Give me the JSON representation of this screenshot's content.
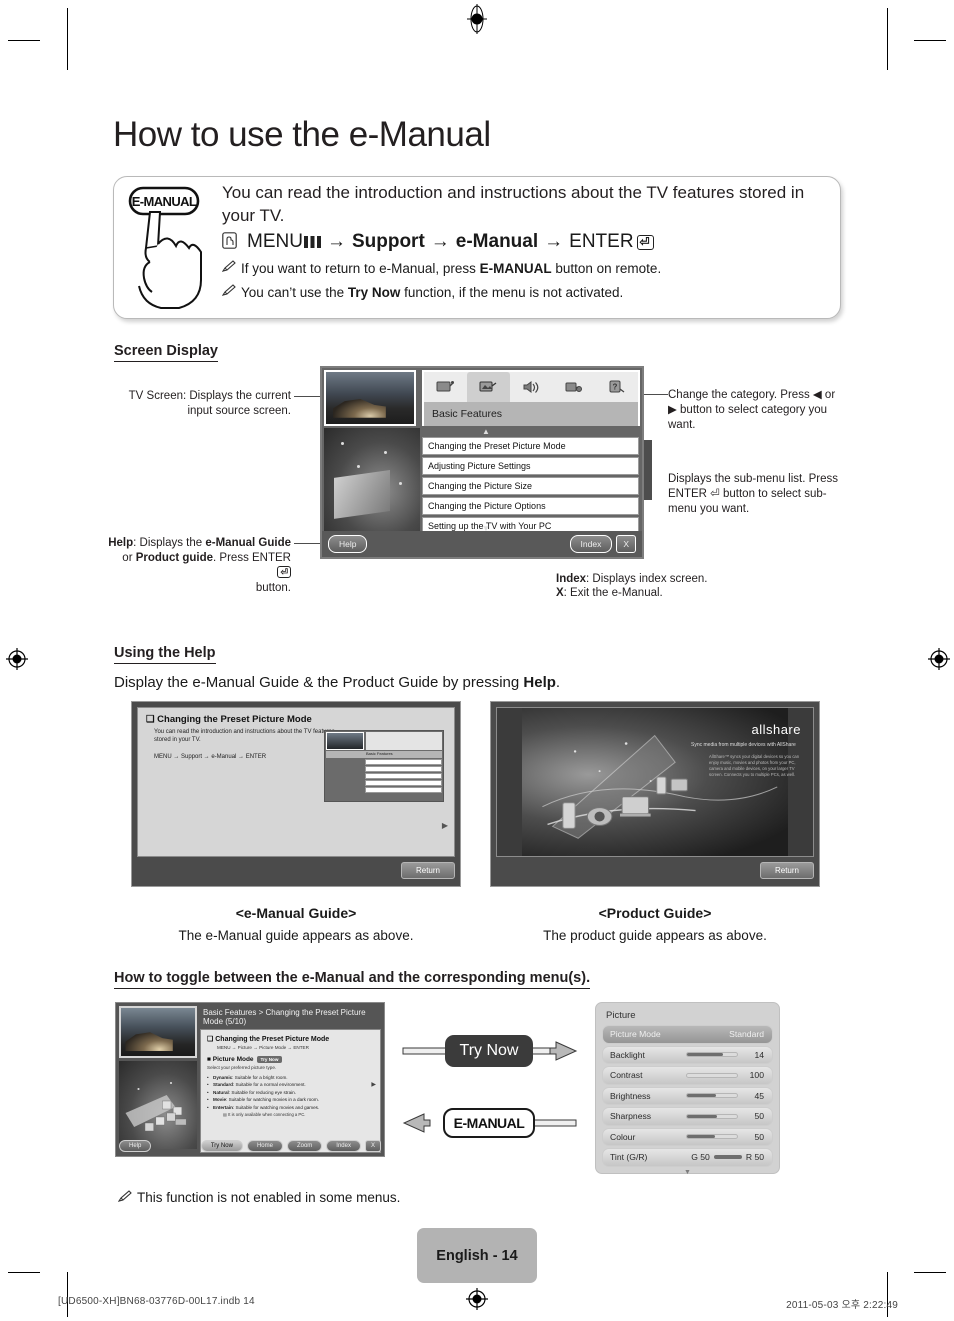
{
  "page": {
    "title": "How to use the e-Manual",
    "page_badge": "English - 14",
    "footer_left": "[UD6500-XH]BN68-03776D-00L17.indb   14",
    "footer_right": "2011-05-03   오후 2:22:49"
  },
  "infobox": {
    "button_label": "E-MANUAL",
    "lead": "You can read the introduction and instructions about the TV features stored in your TV.",
    "path": {
      "menu": "MENU",
      "arrow": "→",
      "support": "Support",
      "emanual": "e-Manual",
      "enter": "ENTER"
    },
    "notes": [
      {
        "pre": "If you want to return to e-Manual, press ",
        "bold": "E-MANUAL",
        "post": " button on remote."
      },
      {
        "pre": "You can’t use the ",
        "bold": "Try Now",
        "post": " function, if the menu is not activated."
      }
    ]
  },
  "screen_display": {
    "heading": "Screen Display",
    "anno_tv_screen": "TV Screen: Displays the current input source screen.",
    "anno_help_1": "Help",
    "anno_help_2": ": Displays the ",
    "anno_help_3": "e-Manual Guide",
    "anno_help_4": " or ",
    "anno_help_5": "Product guide",
    "anno_help_6": ". Press ENTER",
    "anno_help_7": "button.",
    "anno_category": "Change the category. Press ◀ or ▶ button to select category you want.",
    "anno_submenu": "Displays the sub-menu list. Press ENTER ⏎ button to select sub-menu you want.",
    "anno_index_1": "Index",
    "anno_index_2": ": Displays index screen.",
    "anno_x_1": "X",
    "anno_x_2": ": Exit the e-Manual.",
    "ui": {
      "category_title": "Basic Features",
      "categories": [
        "tv-icon",
        "picture-icon",
        "sound-icon",
        "network-icon",
        "support-icon"
      ],
      "selected_category_index": 1,
      "menu_items": [
        "Changing the Preset Picture Mode",
        "Adjusting Picture Settings",
        "Changing the Picture Size",
        "Changing the Picture Options",
        "Setting up the TV with Your PC"
      ],
      "help_key": "Help",
      "index_key": "Index",
      "exit_key": "X"
    }
  },
  "using_help": {
    "heading": "Using the Help",
    "intro_pre": "Display the e-Manual Guide & the Product Guide by pressing ",
    "intro_bold": "Help",
    "intro_post": ".",
    "emanual_guide": {
      "screen_title": "Changing the Preset Picture Mode",
      "body": "You can read the introduction and instructions about the TV features stored in your TV.",
      "path": "MENU      →  Support  →  e-Manual  →  ENTER",
      "return_key": "Return",
      "caption_title": "<e-Manual Guide>",
      "caption_sub": "The e-Manual guide appears as above."
    },
    "product_guide": {
      "logo": "allshare",
      "tagline": "Sync media from multiple devices with AllShare",
      "body": "AllShare™ syncs your digital devices so you can enjoy music, movies and photos from your PC, camera and mobile devices, on your larger TV screen. Connects you to multiple PCs, as well.",
      "return_key": "Return",
      "caption_title": "<Product Guide>",
      "caption_sub": "The product guide appears as above."
    }
  },
  "toggle": {
    "heading": "How to toggle between the e-Manual and the corresponding menu(s).",
    "try_now_label": "Try Now",
    "emanual_label": "E-MANUAL",
    "note": "This function is not enabled in some menus.",
    "tv_screen": {
      "breadcrumb": "Basic Features > Changing the Preset Picture Mode (5/10)",
      "title": "Changing the Preset Picture Mode",
      "path": "MENU    → Picture → Picture Mode → ENTER",
      "section": "Picture Mode",
      "badge": "Try Now",
      "subtitle": "Select your preferred picture type.",
      "options": [
        {
          "name": "Dynamic",
          "desc": ": Suitable for a bright room."
        },
        {
          "name": "Standard",
          "desc": ": Suitable for a normal environment."
        },
        {
          "name": "Natural",
          "desc": ": Suitable for reducing eye strain."
        },
        {
          "name": "Movie",
          "desc": ": Suitable for watching movies in a dark room."
        },
        {
          "name": "Entertain",
          "desc": ": Suitable for watching movies and games."
        }
      ],
      "footnote": "It is only available when connecting a PC.",
      "keys": [
        "Help",
        "Try Now",
        "Home",
        "Zoom",
        "Index",
        "X"
      ]
    },
    "picture_menu": {
      "title": "Picture",
      "rows": [
        {
          "label": "Picture Mode",
          "value": "Standard",
          "selected": true,
          "bar": null
        },
        {
          "label": "Backlight",
          "value": "14",
          "selected": false,
          "bar": 72
        },
        {
          "label": "Contrast",
          "value": "100",
          "selected": false,
          "bar": 0
        },
        {
          "label": "Brightness",
          "value": "45",
          "selected": false,
          "bar": 58
        },
        {
          "label": "Sharpness",
          "value": "50",
          "selected": false,
          "bar": 60
        },
        {
          "label": "Colour",
          "value": "50",
          "selected": false,
          "bar": 55
        }
      ],
      "tint_label": "Tint (G/R)",
      "tint_g": "G 50",
      "tint_r": "R 50"
    }
  }
}
